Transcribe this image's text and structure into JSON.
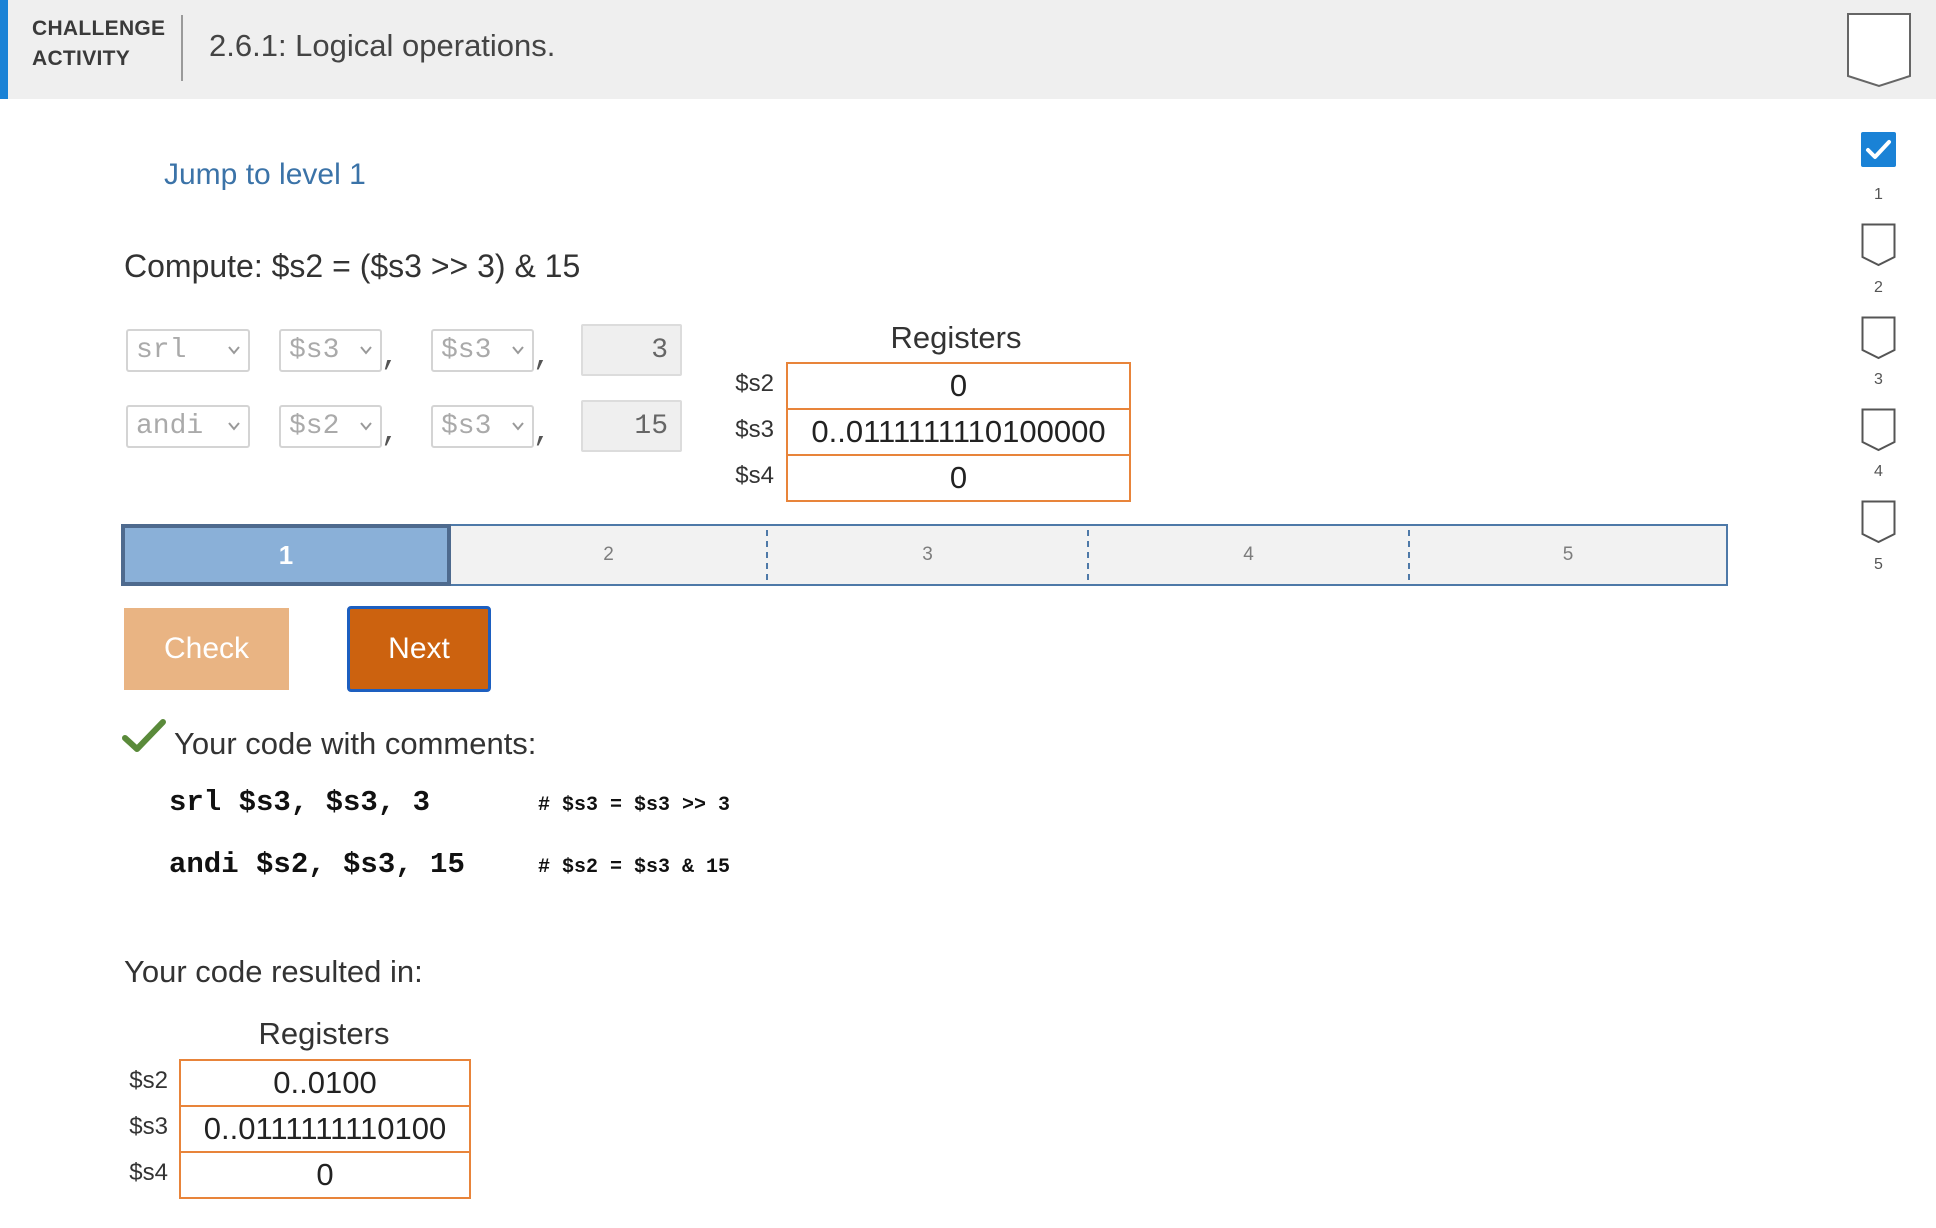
{
  "header": {
    "label_line1": "CHALLENGE",
    "label_line2": "ACTIVITY",
    "title": "2.6.1: Logical operations."
  },
  "jump_link": "Jump to level 1",
  "prompt": "Compute: $s2 = ($s3 >> 3) & 15",
  "instructions": [
    {
      "op": "srl",
      "rd": "$s3",
      "rs": "$s3",
      "imm": "3"
    },
    {
      "op": "andi",
      "rd": "$s2",
      "rs": "$s3",
      "imm": "15"
    }
  ],
  "comma": ",",
  "registers": {
    "title": "Registers",
    "rows": [
      {
        "name": "$s2",
        "value": "0"
      },
      {
        "name": "$s3",
        "value": "0..0111111110100000"
      },
      {
        "name": "$s4",
        "value": "0"
      }
    ]
  },
  "progress": {
    "current_level": 1,
    "levels": [
      "1",
      "2",
      "3",
      "4",
      "5"
    ]
  },
  "buttons": {
    "check": "Check",
    "next": "Next"
  },
  "feedback": {
    "heading": "Your code with comments:",
    "lines": [
      {
        "code": "srl $s3, $s3, 3",
        "comment": "# $s3 = $s3 >> 3"
      },
      {
        "code": "andi $s2, $s3, 15",
        "comment": "# $s2 = $s3 & 15"
      }
    ]
  },
  "result": {
    "heading": "Your code resulted in:",
    "title": "Registers",
    "rows": [
      {
        "name": "$s2",
        "value": "0..0100"
      },
      {
        "name": "$s3",
        "value": "0..0111111110100"
      },
      {
        "name": "$s4",
        "value": "0"
      }
    ]
  },
  "side_levels": {
    "items": [
      "1",
      "2",
      "3",
      "4",
      "5"
    ],
    "completed": [
      true,
      false,
      false,
      false,
      false
    ]
  },
  "colors": {
    "accent": "#1a82d6",
    "register_border": "#e8843a",
    "progress_active": "#8ab0d8",
    "check_button": "#e9b483",
    "next_button": "#cc620f"
  }
}
